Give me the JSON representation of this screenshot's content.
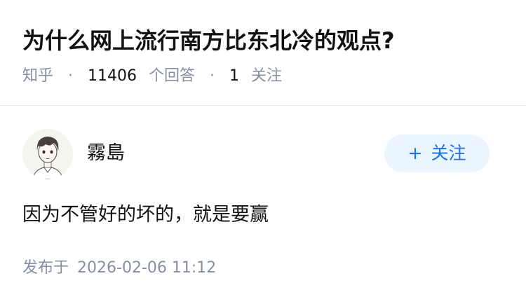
{
  "question": {
    "title": "为什么网上流行南方比东北冷的观点?",
    "source": "知乎",
    "answers_count": "11406",
    "answers_label": "个回答",
    "followers_count": "1",
    "followers_label": "关注",
    "separator": "·"
  },
  "answer": {
    "author": {
      "name": "霧島",
      "avatar_icon": "avatar-cartoon-boy"
    },
    "follow_button": {
      "plus": "+",
      "label": "关注"
    },
    "content": "因为不管好的坏的，就是要赢",
    "time_label": "发布于",
    "timestamp": "2026-02-06 11:12"
  },
  "colors": {
    "title": "#121212",
    "meta": "#8590a6",
    "follow_bg": "#ebf5ff",
    "follow_text": "#1772f6",
    "divider": "#ebebeb"
  }
}
